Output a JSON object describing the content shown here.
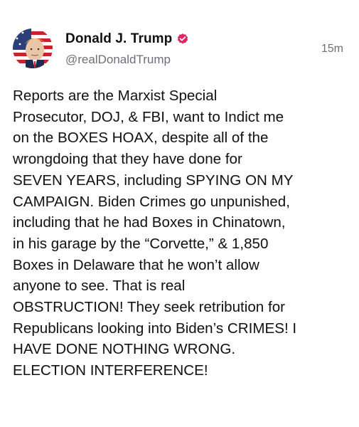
{
  "post": {
    "author": {
      "display_name": "Donald J. Trump",
      "handle": "@realDonaldTrump",
      "verified_icon": "verified-badge-icon",
      "verified_color": "#e0245e",
      "avatar_icon": "profile-avatar"
    },
    "timestamp": "15m",
    "text": "Reports are the Marxist Special\nProsecutor, DOJ, & FBI, want to Indict me\non the BOXES HOAX, despite all of the\nwrongdoing that they have done for\nSEVEN YEARS, including SPYING ON MY\nCAMPAIGN. Biden Crimes go unpunished,\nincluding that he had Boxes in Chinatown,\nin his garage by the “Corvette,” & 1,850\nBoxes in Delaware that he won’t allow\nanyone to see. That is real\nOBSTRUCTION! They seek retribution for\nRepublicans looking into Biden’s CRIMES! I\nHAVE DONE NOTHING WRONG.\nELECTION INTERFERENCE!"
  },
  "colors": {
    "text_primary": "#111111",
    "text_secondary": "#6b7078",
    "background": "#ffffff"
  }
}
